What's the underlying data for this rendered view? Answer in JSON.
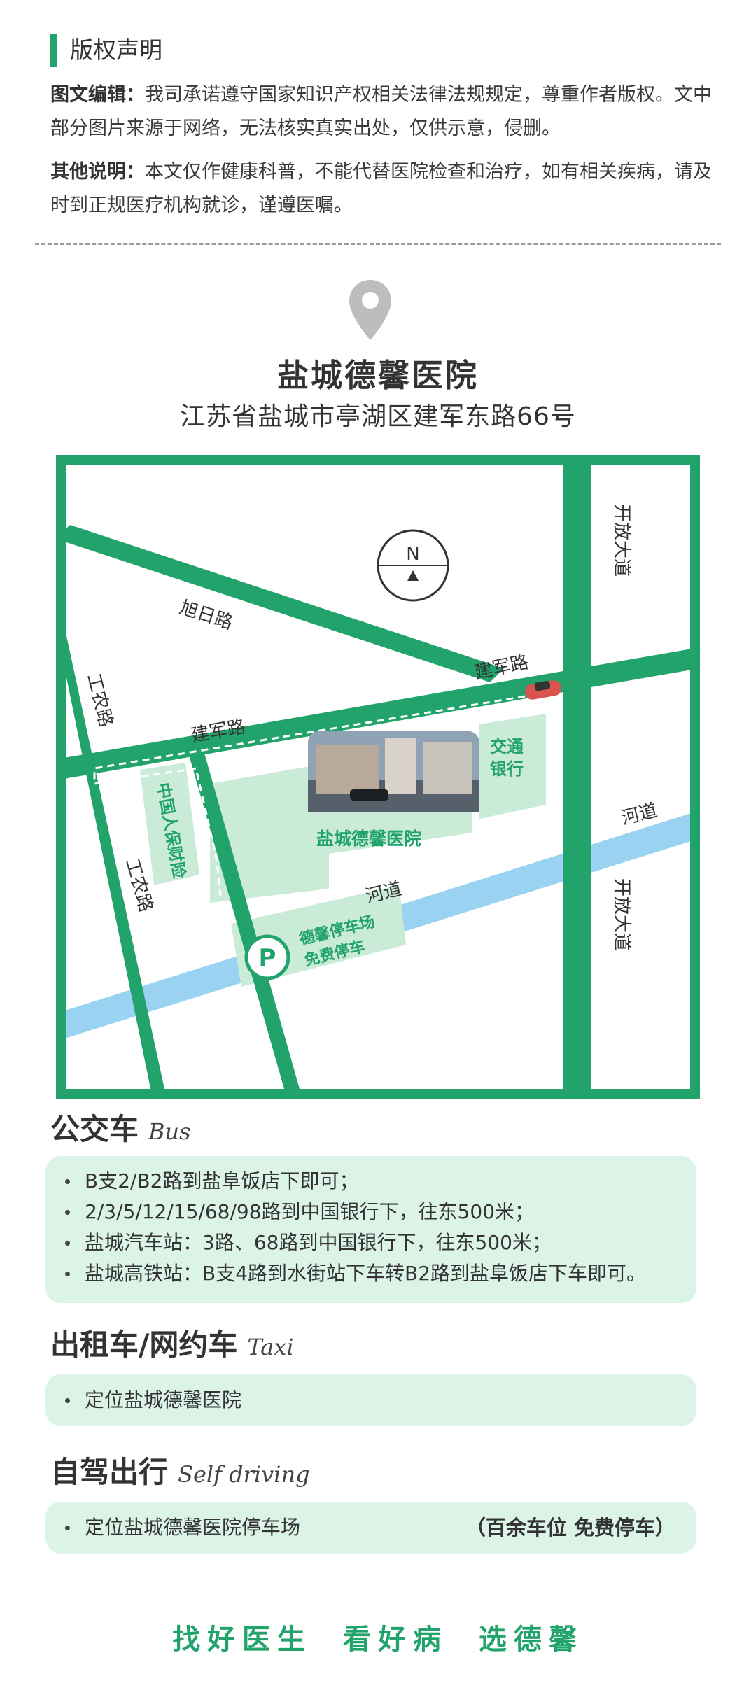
{
  "copyright": {
    "title": "版权声明",
    "p1_label": "图文编辑：",
    "p1_text": "我司承诺遵守国家知识产权相关法律法规规定，尊重作者版权。文中部分图片来源于网络，无法核实真实出处，仅供示意，侵删。",
    "p2_label": "其他说明：",
    "p2_text": "本文仅作健康科普，不能代替医院检查和治疗，如有相关疾病，请及时到正规医疗机构就诊，谨遵医嘱。"
  },
  "hospital": {
    "name": "盐城德馨医院",
    "address": "江苏省盐城市亭湖区建军东路66号"
  },
  "map": {
    "compass": "N",
    "kaifang_top": "开放大道",
    "kaifang_bottom": "开放大道",
    "xuri": "旭日路",
    "jianjun_right": "建军路",
    "jianjun_left": "建军路",
    "gongnong_top": "工农路",
    "gongnong_bottom": "工农路",
    "bank": "交通银行",
    "insurance": "中国人保财险",
    "hospital_label": "盐城德馨医院",
    "river_left": "河道",
    "river_right": "河道",
    "parking_line1": "德馨停车场",
    "parking_line2": "免费停车",
    "parking_icon": "P",
    "colors": {
      "road": "#21a36b",
      "river": "#9ad3f2",
      "block": "#c9ebd8"
    }
  },
  "bus": {
    "title": "公交车",
    "title_en": "Bus",
    "items": [
      "B支2/B2路到盐阜饭店下即可；",
      "2/3/5/12/15/68/98路到中国银行下，往东500米；",
      "盐城汽车站：3路、68路到中国银行下，往东500米；",
      "盐城高铁站：B支4路到水街站下车转B2路到盐阜饭店下车即可。"
    ]
  },
  "taxi": {
    "title": "出租车/网约车",
    "title_en": "Taxi",
    "items": [
      "定位盐城德馨医院"
    ]
  },
  "drive": {
    "title": "自驾出行",
    "title_en": "Self driving",
    "item": "定位盐城德馨医院停车场",
    "note": "（百余车位 免费停车）"
  },
  "slogan": "找好医生 看好病 选德馨"
}
